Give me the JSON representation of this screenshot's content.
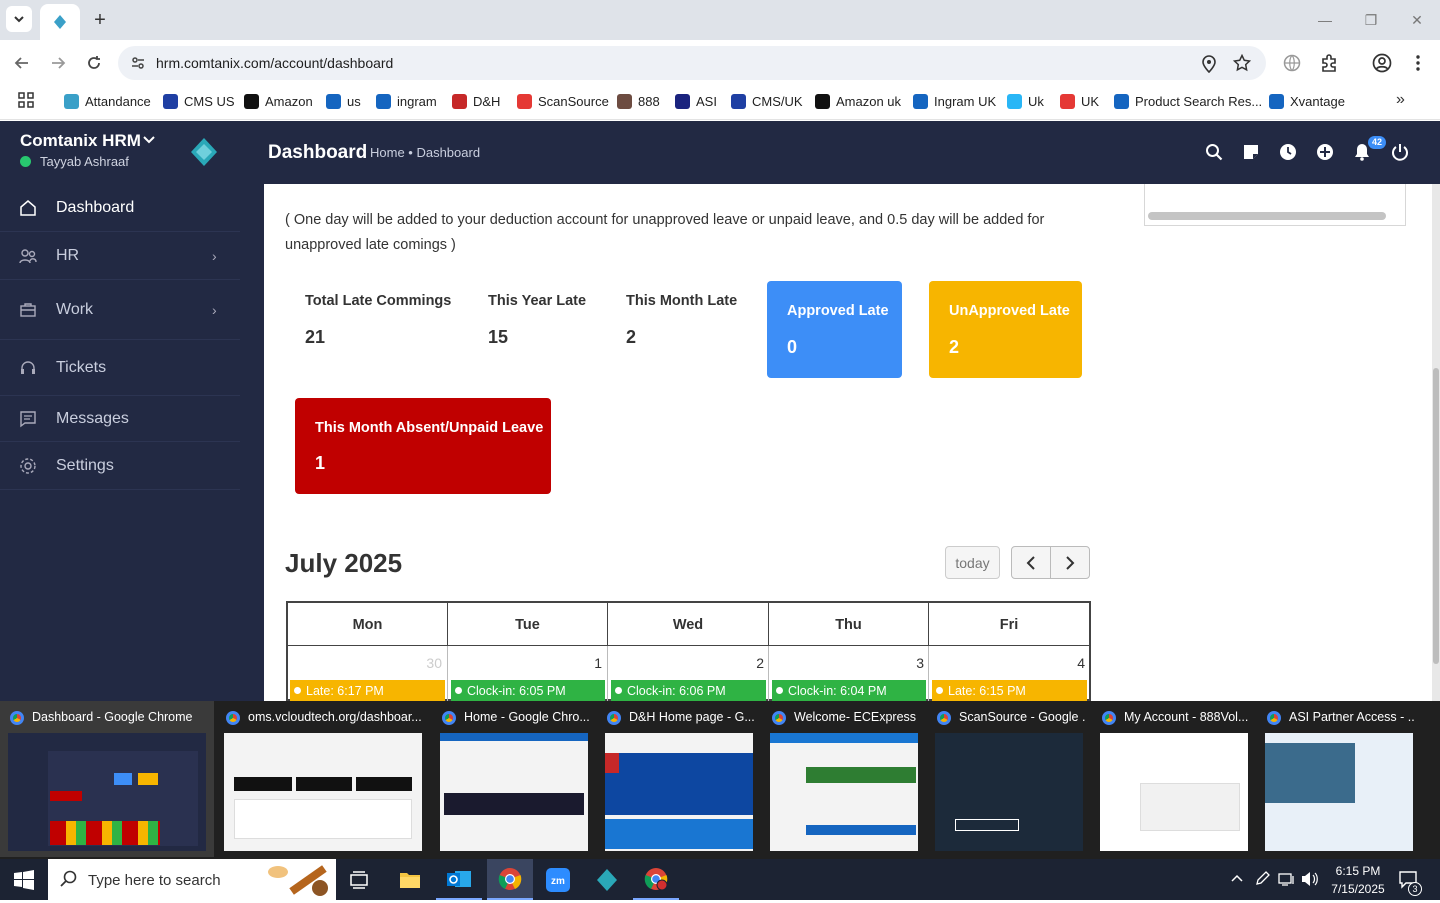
{
  "browser": {
    "url": "hrm.comtanix.com/account/dashboard",
    "bookmarks": [
      {
        "label": "Attandance",
        "color": "#3aa0c8"
      },
      {
        "label": "CMS US",
        "color": "#1f3fa3"
      },
      {
        "label": "Amazon",
        "color": "#111111"
      },
      {
        "label": "us",
        "color": "#1565c0"
      },
      {
        "label": "ingram",
        "color": "#1565c0"
      },
      {
        "label": "D&H",
        "color": "#c62828"
      },
      {
        "label": "ScanSource",
        "color": "#e53935"
      },
      {
        "label": "888",
        "color": "#6d4c41"
      },
      {
        "label": "ASI",
        "color": "#1a237e"
      },
      {
        "label": "CMS/UK",
        "color": "#1f3fa3"
      },
      {
        "label": "Amazon uk",
        "color": "#111111"
      },
      {
        "label": "Ingram UK",
        "color": "#1565c0"
      },
      {
        "label": "Uk",
        "color": "#29b6f6"
      },
      {
        "label": "UK",
        "color": "#e53935"
      },
      {
        "label": "Product Search Res...",
        "color": "#1565c0"
      },
      {
        "label": "Xvantage",
        "color": "#1565c0"
      }
    ]
  },
  "sidebar": {
    "brand": "Comtanix HRM",
    "user": "Tayyab Ashraaf",
    "items": [
      {
        "label": "Dashboard",
        "icon": "home-icon"
      },
      {
        "label": "HR",
        "icon": "users-icon"
      },
      {
        "label": "Work",
        "icon": "briefcase-icon"
      },
      {
        "label": "Tickets",
        "icon": "headset-icon"
      },
      {
        "label": "Messages",
        "icon": "message-icon"
      },
      {
        "label": "Settings",
        "icon": "gear-icon"
      }
    ]
  },
  "header": {
    "title": "Dashboard",
    "breadcrumb": "Home • Dashboard",
    "notification_count": "42"
  },
  "main": {
    "note": "( One day will be added to your deduction account for unapproved leave or unpaid leave, and 0.5 day will be added for unapproved late comings )",
    "stats": [
      {
        "label": "Total Late Commings",
        "value": "21"
      },
      {
        "label": "This Year Late",
        "value": "15"
      },
      {
        "label": "This Month Late",
        "value": "2"
      }
    ],
    "tiles": [
      {
        "label": "Approved Late",
        "value": "0",
        "color": "#3d8ef7"
      },
      {
        "label": "UnApproved Late",
        "value": "2",
        "color": "#f7b500"
      },
      {
        "label": "This Month Absent/Unpaid Leave",
        "value": "1",
        "color": "#c00000"
      }
    ]
  },
  "calendar": {
    "month": "July 2025",
    "today_label": "today",
    "days": [
      "Mon",
      "Tue",
      "Wed",
      "Thu",
      "Fri"
    ],
    "dates": [
      "30",
      "1",
      "2",
      "3",
      "4"
    ],
    "events": [
      {
        "text": "Late: 6:17 PM",
        "color": "#f7b500"
      },
      {
        "text": "Clock-in: 6:05 PM",
        "color": "#2fb344"
      },
      {
        "text": "Clock-in: 6:06 PM",
        "color": "#2fb344"
      },
      {
        "text": "Clock-in: 6:04 PM",
        "color": "#2fb344"
      },
      {
        "text": "Late: 6:15 PM",
        "color": "#f7b500"
      }
    ]
  },
  "taskbar": {
    "thumbnails": [
      "Dashboard - Google Chrome",
      "oms.vcloudtech.org/dashboar...",
      "Home - Google Chro...",
      "D&H Home page - G...",
      "Welcome- ECExpress ...",
      "ScanSource - Google ...",
      "My Account - 888Vol...",
      "ASI Partner Access - ..."
    ],
    "search_placeholder": "Type here to search",
    "time": "6:15 PM",
    "date": "7/15/2025",
    "notifications": "3"
  }
}
